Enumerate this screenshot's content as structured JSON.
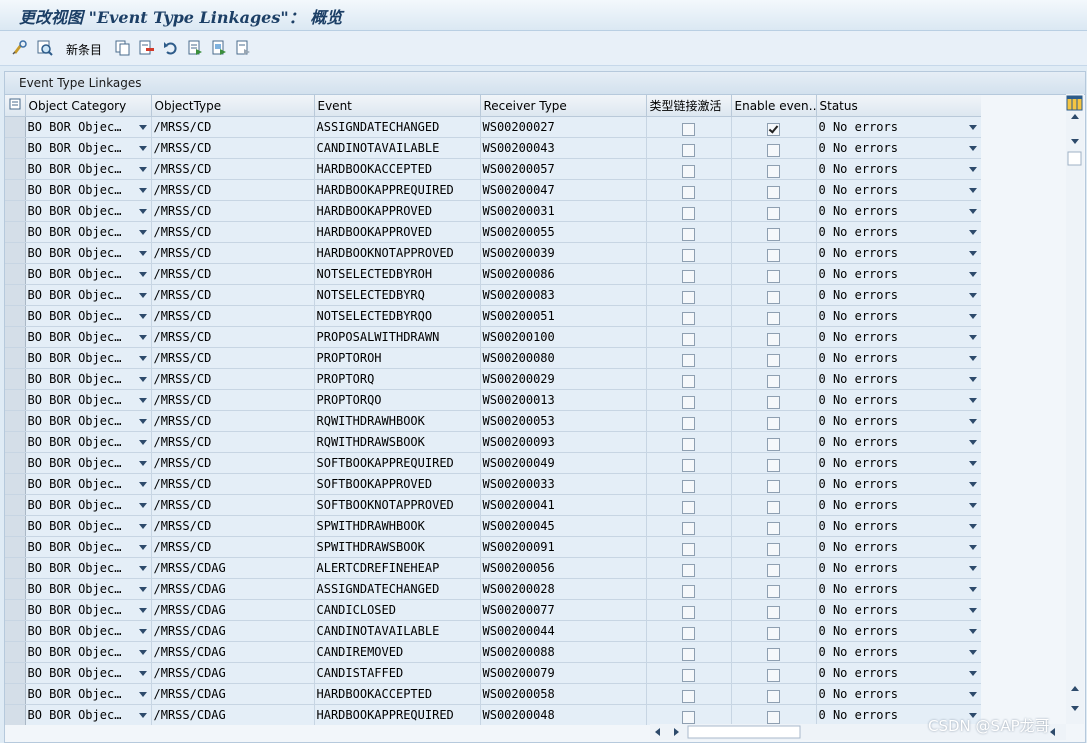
{
  "window": {
    "title": "更改视图 \"Event Type Linkages\"： 概览"
  },
  "toolbar": {
    "new_entries_label": "新条目",
    "icons": [
      "display-change-icon",
      "details-icon",
      "copy-icon",
      "delete-icon",
      "undo-icon",
      "select-all-icon",
      "select-block-icon",
      "deselect-all-icon"
    ]
  },
  "panel": {
    "title": "Event Type Linkages"
  },
  "table": {
    "columns": [
      "Object Category",
      "ObjectType",
      "Event",
      "Receiver Type",
      "类型链接激活",
      "Enable even…",
      "Status"
    ],
    "rows": [
      {
        "category": "BO BOR Objec…",
        "object_type": "/MRSS/CD",
        "event": "ASSIGNDATECHANGED",
        "receiver": "WS00200027",
        "active": false,
        "enable": true,
        "status": "0 No errors"
      },
      {
        "category": "BO BOR Objec…",
        "object_type": "/MRSS/CD",
        "event": "CANDINOTAVAILABLE",
        "receiver": "WS00200043",
        "active": false,
        "enable": false,
        "status": "0 No errors"
      },
      {
        "category": "BO BOR Objec…",
        "object_type": "/MRSS/CD",
        "event": "HARDBOOKACCEPTED",
        "receiver": "WS00200057",
        "active": false,
        "enable": false,
        "status": "0 No errors"
      },
      {
        "category": "BO BOR Objec…",
        "object_type": "/MRSS/CD",
        "event": "HARDBOOKAPPREQUIRED",
        "receiver": "WS00200047",
        "active": false,
        "enable": false,
        "status": "0 No errors"
      },
      {
        "category": "BO BOR Objec…",
        "object_type": "/MRSS/CD",
        "event": "HARDBOOKAPPROVED",
        "receiver": "WS00200031",
        "active": false,
        "enable": false,
        "status": "0 No errors"
      },
      {
        "category": "BO BOR Objec…",
        "object_type": "/MRSS/CD",
        "event": "HARDBOOKAPPROVED",
        "receiver": "WS00200055",
        "active": false,
        "enable": false,
        "status": "0 No errors"
      },
      {
        "category": "BO BOR Objec…",
        "object_type": "/MRSS/CD",
        "event": "HARDBOOKNOTAPPROVED",
        "receiver": "WS00200039",
        "active": false,
        "enable": false,
        "status": "0 No errors"
      },
      {
        "category": "BO BOR Objec…",
        "object_type": "/MRSS/CD",
        "event": "NOTSELECTEDBYROH",
        "receiver": "WS00200086",
        "active": false,
        "enable": false,
        "status": "0 No errors"
      },
      {
        "category": "BO BOR Objec…",
        "object_type": "/MRSS/CD",
        "event": "NOTSELECTEDBYRQ",
        "receiver": "WS00200083",
        "active": false,
        "enable": false,
        "status": "0 No errors"
      },
      {
        "category": "BO BOR Objec…",
        "object_type": "/MRSS/CD",
        "event": "NOTSELECTEDBYRQO",
        "receiver": "WS00200051",
        "active": false,
        "enable": false,
        "status": "0 No errors"
      },
      {
        "category": "BO BOR Objec…",
        "object_type": "/MRSS/CD",
        "event": "PROPOSALWITHDRAWN",
        "receiver": "WS00200100",
        "active": false,
        "enable": false,
        "status": "0 No errors"
      },
      {
        "category": "BO BOR Objec…",
        "object_type": "/MRSS/CD",
        "event": "PROPTOROH",
        "receiver": "WS00200080",
        "active": false,
        "enable": false,
        "status": "0 No errors"
      },
      {
        "category": "BO BOR Objec…",
        "object_type": "/MRSS/CD",
        "event": "PROPTORQ",
        "receiver": "WS00200029",
        "active": false,
        "enable": false,
        "status": "0 No errors"
      },
      {
        "category": "BO BOR Objec…",
        "object_type": "/MRSS/CD",
        "event": "PROPTORQO",
        "receiver": "WS00200013",
        "active": false,
        "enable": false,
        "status": "0 No errors"
      },
      {
        "category": "BO BOR Objec…",
        "object_type": "/MRSS/CD",
        "event": "RQWITHDRAWHBOOK",
        "receiver": "WS00200053",
        "active": false,
        "enable": false,
        "status": "0 No errors"
      },
      {
        "category": "BO BOR Objec…",
        "object_type": "/MRSS/CD",
        "event": "RQWITHDRAWSBOOK",
        "receiver": "WS00200093",
        "active": false,
        "enable": false,
        "status": "0 No errors"
      },
      {
        "category": "BO BOR Objec…",
        "object_type": "/MRSS/CD",
        "event": "SOFTBOOKAPPREQUIRED",
        "receiver": "WS00200049",
        "active": false,
        "enable": false,
        "status": "0 No errors"
      },
      {
        "category": "BO BOR Objec…",
        "object_type": "/MRSS/CD",
        "event": "SOFTBOOKAPPROVED",
        "receiver": "WS00200033",
        "active": false,
        "enable": false,
        "status": "0 No errors"
      },
      {
        "category": "BO BOR Objec…",
        "object_type": "/MRSS/CD",
        "event": "SOFTBOOKNOTAPPROVED",
        "receiver": "WS00200041",
        "active": false,
        "enable": false,
        "status": "0 No errors"
      },
      {
        "category": "BO BOR Objec…",
        "object_type": "/MRSS/CD",
        "event": "SPWITHDRAWHBOOK",
        "receiver": "WS00200045",
        "active": false,
        "enable": false,
        "status": "0 No errors"
      },
      {
        "category": "BO BOR Objec…",
        "object_type": "/MRSS/CD",
        "event": "SPWITHDRAWSBOOK",
        "receiver": "WS00200091",
        "active": false,
        "enable": false,
        "status": "0 No errors"
      },
      {
        "category": "BO BOR Objec…",
        "object_type": "/MRSS/CDAG",
        "event": "ALERTCDREFINEHEAP",
        "receiver": "WS00200056",
        "active": false,
        "enable": false,
        "status": "0 No errors"
      },
      {
        "category": "BO BOR Objec…",
        "object_type": "/MRSS/CDAG",
        "event": "ASSIGNDATECHANGED",
        "receiver": "WS00200028",
        "active": false,
        "enable": false,
        "status": "0 No errors"
      },
      {
        "category": "BO BOR Objec…",
        "object_type": "/MRSS/CDAG",
        "event": "CANDICLOSED",
        "receiver": "WS00200077",
        "active": false,
        "enable": false,
        "status": "0 No errors"
      },
      {
        "category": "BO BOR Objec…",
        "object_type": "/MRSS/CDAG",
        "event": "CANDINOTAVAILABLE",
        "receiver": "WS00200044",
        "active": false,
        "enable": false,
        "status": "0 No errors"
      },
      {
        "category": "BO BOR Objec…",
        "object_type": "/MRSS/CDAG",
        "event": "CANDIREMOVED",
        "receiver": "WS00200088",
        "active": false,
        "enable": false,
        "status": "0 No errors"
      },
      {
        "category": "BO BOR Objec…",
        "object_type": "/MRSS/CDAG",
        "event": "CANDISTAFFED",
        "receiver": "WS00200079",
        "active": false,
        "enable": false,
        "status": "0 No errors"
      },
      {
        "category": "BO BOR Objec…",
        "object_type": "/MRSS/CDAG",
        "event": "HARDBOOKACCEPTED",
        "receiver": "WS00200058",
        "active": false,
        "enable": false,
        "status": "0 No errors"
      },
      {
        "category": "BO BOR Objec…",
        "object_type": "/MRSS/CDAG",
        "event": "HARDBOOKAPPREQUIRED",
        "receiver": "WS00200048",
        "active": false,
        "enable": false,
        "status": "0 No errors"
      }
    ]
  },
  "watermark": "CSDN @SAP龙哥"
}
